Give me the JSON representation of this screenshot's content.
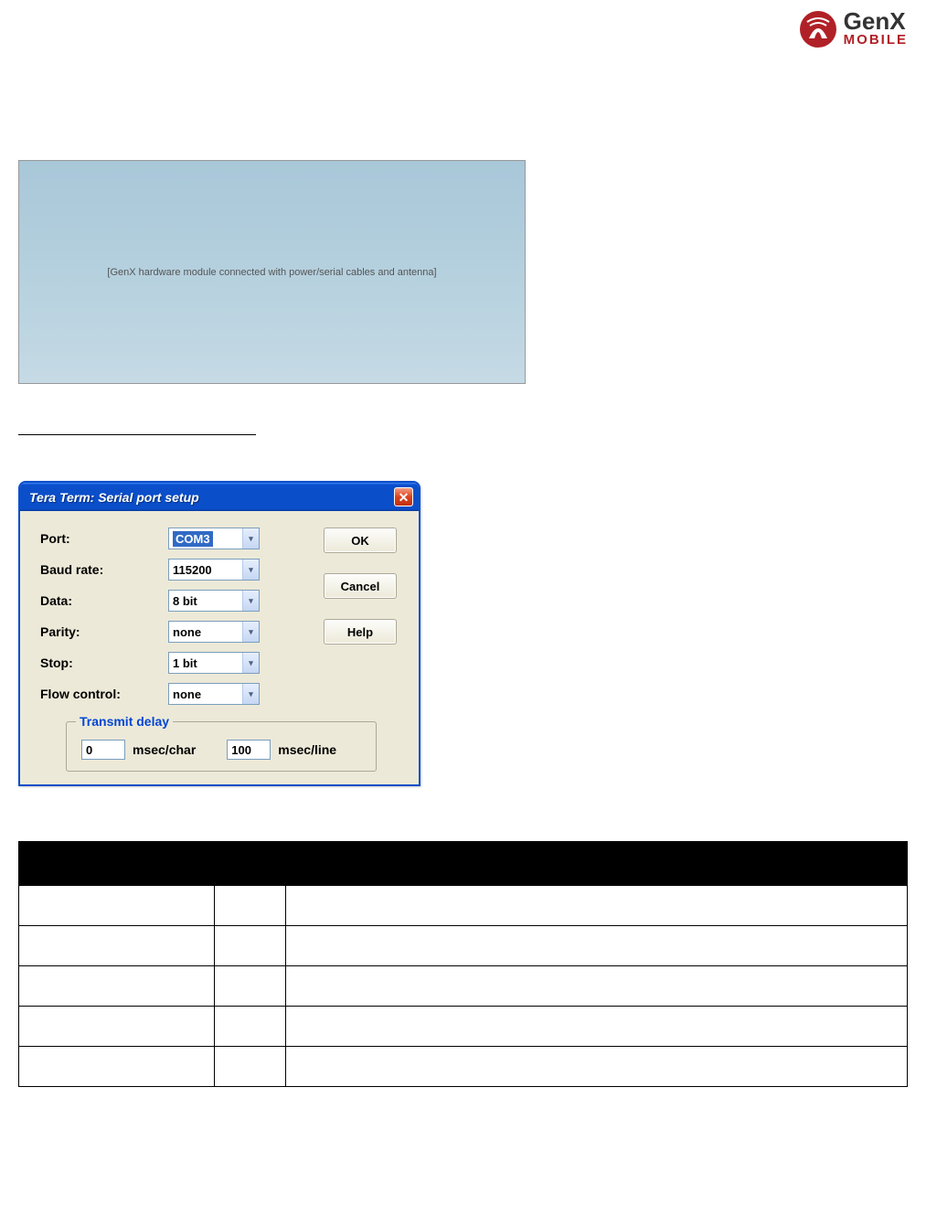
{
  "logo": {
    "main": "GenX",
    "sub": "MOBILE"
  },
  "hardware_photo_alt": "[GenX hardware module connected with power/serial cables and antenna]",
  "dialog": {
    "title": "Tera Term: Serial port setup",
    "close": "✕",
    "fields": {
      "port": {
        "label": "Port:",
        "value": "COM3"
      },
      "baud": {
        "label": "Baud rate:",
        "value": "115200"
      },
      "data": {
        "label": "Data:",
        "value": "8 bit"
      },
      "parity": {
        "label": "Parity:",
        "value": "none"
      },
      "stop": {
        "label": "Stop:",
        "value": "1 bit"
      },
      "flow": {
        "label": "Flow control:",
        "value": "none"
      }
    },
    "transmit_delay": {
      "legend": "Transmit delay",
      "char_value": "0",
      "char_label": "msec/char",
      "line_value": "100",
      "line_label": "msec/line"
    },
    "buttons": {
      "ok": "OK",
      "cancel": "Cancel",
      "help": "Help"
    }
  },
  "table": {
    "rows": 5,
    "cols": 3
  }
}
